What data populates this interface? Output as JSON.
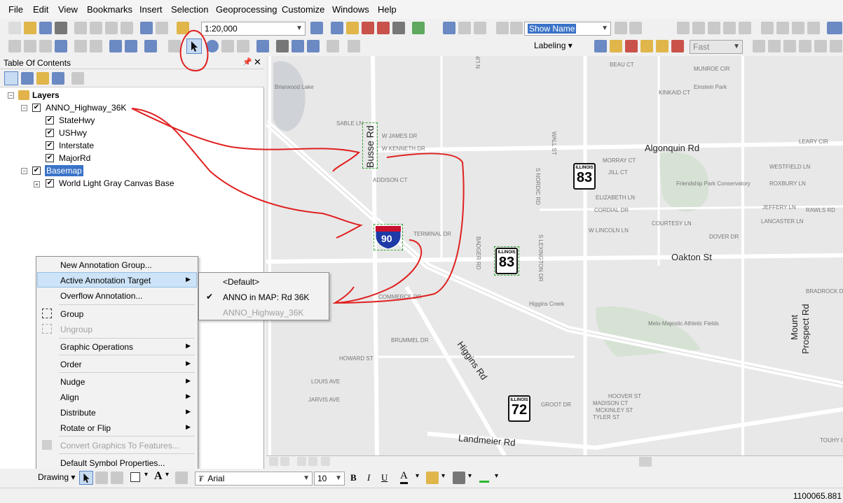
{
  "menubar": {
    "items": [
      "File",
      "Edit",
      "View",
      "Bookmarks",
      "Insert",
      "Selection",
      "Geoprocessing",
      "Customize",
      "Windows",
      "Help"
    ]
  },
  "toolbar": {
    "scale": "1:20,000",
    "show_name": "Show Name",
    "labeling": "Labeling",
    "fast": "Fast"
  },
  "toc": {
    "title": "Table Of Contents",
    "root": "Layers",
    "layers": [
      {
        "name": "ANNO_Highway_36K",
        "children": [
          "StateHwy",
          "USHwy",
          "Interstate",
          "MajorRd"
        ]
      },
      {
        "name": "Basemap",
        "children": [
          "World Light Gray Canvas Base"
        ]
      }
    ]
  },
  "context_menu": {
    "items": [
      {
        "label": "New Annotation Group..."
      },
      {
        "label": "Active Annotation Target"
      },
      {
        "label": "Overflow Annotation..."
      },
      {
        "label": "Group"
      },
      {
        "label": "Ungroup"
      },
      {
        "label": "Graphic Operations"
      },
      {
        "label": "Order"
      },
      {
        "label": "Nudge"
      },
      {
        "label": "Align"
      },
      {
        "label": "Distribute"
      },
      {
        "label": "Rotate or Flip"
      },
      {
        "label": "Convert Graphics To Features..."
      },
      {
        "label": "Default Symbol Properties..."
      }
    ],
    "submenu": [
      "<Default>",
      "ANNO in MAP: Rd 36K",
      "ANNO_Highway_36K"
    ]
  },
  "map": {
    "roads": {
      "busse": "Busse Rd",
      "algonquin": "Algonquin Rd",
      "oakton": "Oakton St",
      "higgins": "Higgins Rd",
      "landmeier": "Landmeier Rd",
      "mount_prospect_1": "Mount",
      "mount_prospect_2": "Prospect Rd"
    },
    "shields": {
      "interstate": "90",
      "state": "83",
      "state2": "83",
      "state3": "72",
      "state_label": "ILLINOIS"
    },
    "place_labels": {
      "lake": "Briarwood Lake",
      "park": "Einstein Park",
      "friendship": "Friendship Park Conservatory",
      "metro": "Melo-Majestic Athletic Fields",
      "creek": "Higgins Creek"
    },
    "streets": [
      "W JAMES DR",
      "W KENNETH DR",
      "SABLE LN",
      "ADDISON CT",
      "TERMINAL DR",
      "MORRAY CT",
      "JILL CT",
      "ELIZABETH LN",
      "CORDIAL DR",
      "W LINCOLN LN",
      "COURTESY LN",
      "DOVER DR",
      "KINKAID CT",
      "BEAU CT",
      "MUNROE CIR",
      "WESTFIELD LN",
      "ROXBURY LN",
      "JEFFERY LN",
      "LANCASTER LN",
      "RAWLS RD",
      "BRADROCK DR",
      "COMMERCE DR",
      "BRUMMEL DR",
      "HOWARD ST",
      "LOUIS AVE",
      "JARVIS AVE",
      "HOOVER ST",
      "MADISON CT",
      "MCKINLEY ST",
      "TYLER ST",
      "GROOT DR",
      "N LINNEMAN RD",
      "WALL ST",
      "S NORDIC RD",
      "S LEXINGTON DR",
      "BADGER RD",
      "LEARY CIR",
      "TOUHY C"
    ]
  },
  "drawbar": {
    "drawing": "Drawing",
    "font": "Arial",
    "size": "10",
    "bold": "B",
    "italic": "I",
    "underline": "U",
    "fontcolor": "A"
  },
  "status": {
    "coords": "1100065.881"
  }
}
